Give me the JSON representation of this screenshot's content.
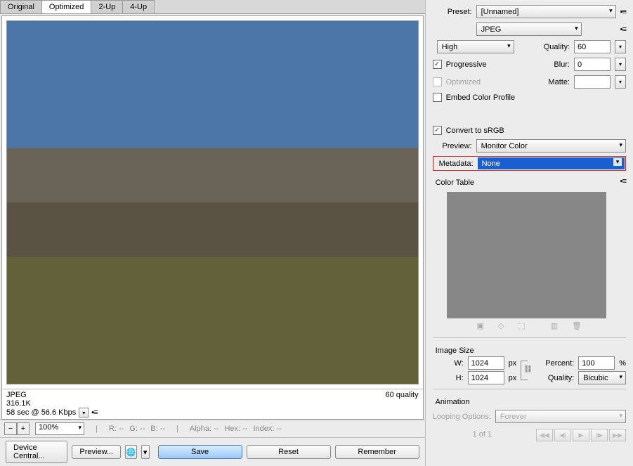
{
  "tabs": {
    "original": "Original",
    "optimized": "Optimized",
    "twoup": "2-Up",
    "fourup": "4-Up"
  },
  "status": {
    "format": "JPEG",
    "size": "316.1K",
    "time_line": "58 sec @ 56.6 Kbps",
    "quality_line": "60 quality"
  },
  "readouts": {
    "zoom": "100%",
    "r": "R: --",
    "g": "G: --",
    "b": "B: --",
    "alpha": "Alpha: --",
    "hex": "Hex: --",
    "index": "Index: --"
  },
  "footer": {
    "device_central": "Device Central...",
    "preview": "Preview...",
    "save": "Save",
    "reset": "Reset",
    "remember": "Remember"
  },
  "preset": {
    "label": "Preset:",
    "value": "[Unnamed]"
  },
  "format": {
    "value": "JPEG"
  },
  "quality_row": {
    "compression": "High",
    "quality_label": "Quality:",
    "quality_value": "60"
  },
  "options": {
    "progressive": "Progressive",
    "optimized": "Optimized",
    "embed_profile": "Embed Color Profile",
    "blur_label": "Blur:",
    "blur_value": "0",
    "matte_label": "Matte:"
  },
  "convert": {
    "srgb": "Convert to sRGB",
    "preview_label": "Preview:",
    "preview_value": "Monitor Color",
    "metadata_label": "Metadata:",
    "metadata_value": "None"
  },
  "color_table": {
    "title": "Color Table"
  },
  "image_size": {
    "title": "Image Size",
    "w_label": "W:",
    "w_value": "1024",
    "h_label": "H:",
    "h_value": "1024",
    "px": "px",
    "percent_label": "Percent:",
    "percent_value": "100",
    "percent_suffix": "%",
    "quality_label": "Quality:",
    "quality_value": "Bicubic"
  },
  "animation": {
    "title": "Animation",
    "looping_label": "Looping Options:",
    "looping_value": "Forever",
    "frame_info": "1 of 1"
  }
}
